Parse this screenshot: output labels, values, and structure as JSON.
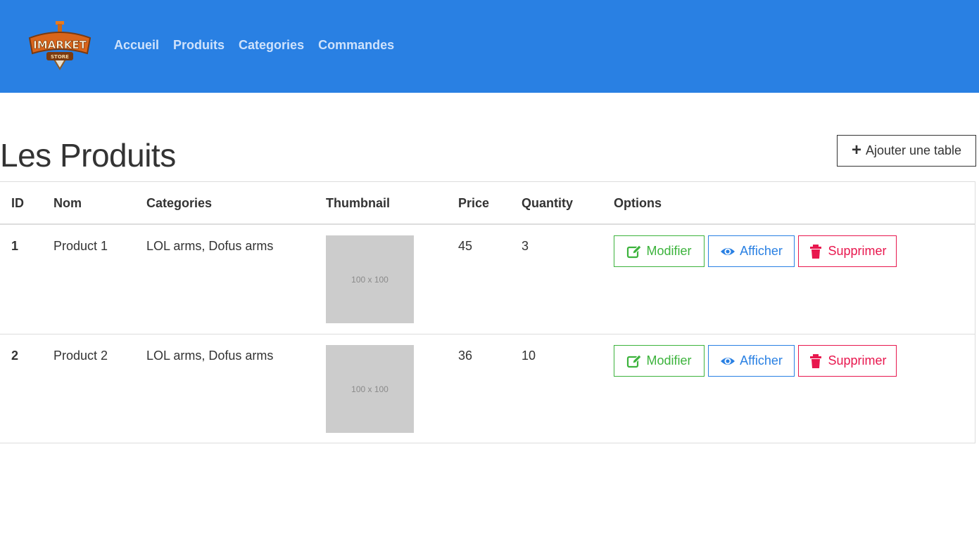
{
  "colors": {
    "navbar_bg": "#2980e3",
    "nav_link": "#cfe2fb",
    "edit": "#3cb33c",
    "view": "#2980e3",
    "delete": "#e8174e",
    "thumbnail_bg": "#cccccc"
  },
  "navbar": {
    "logo_text": "IMARKET",
    "logo_subtext": "STORE",
    "links": [
      "Accueil",
      "Produits",
      "Categories",
      "Commandes"
    ]
  },
  "page": {
    "title": "Les Produits",
    "add_button": {
      "icon": "plus-icon",
      "label": "Ajouter une table"
    }
  },
  "table": {
    "columns": [
      "ID",
      "Nom",
      "Categories",
      "Thumbnail",
      "Price",
      "Quantity",
      "Options"
    ],
    "rows": [
      {
        "id": "1",
        "name": "Product 1",
        "categories": "LOL arms, Dofus arms",
        "thumbnail": "100 x 100",
        "price": "45",
        "quantity": "3"
      },
      {
        "id": "2",
        "name": "Product 2",
        "categories": "LOL arms, Dofus arms",
        "thumbnail": "100 x 100",
        "price": "36",
        "quantity": "10"
      }
    ],
    "actions": {
      "edit": {
        "label": "Modifier",
        "icon": "edit-icon"
      },
      "view": {
        "label": "Afficher",
        "icon": "eye-icon"
      },
      "delete": {
        "label": "Supprimer",
        "icon": "trash-icon"
      }
    }
  }
}
